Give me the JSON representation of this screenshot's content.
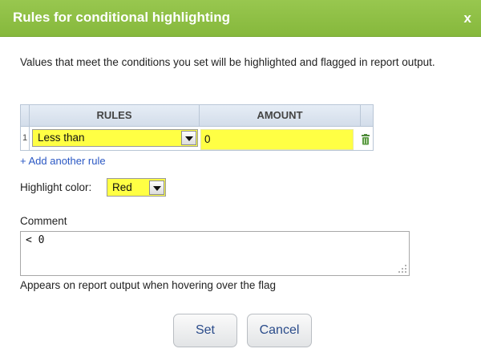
{
  "dialog": {
    "title": "Rules for conditional highlighting",
    "close_label": "x",
    "description": "Values that meet the conditions you set will be highlighted and flagged in report output."
  },
  "rules_table": {
    "columns": [
      "",
      "RULES",
      "AMOUNT",
      ""
    ],
    "rows": [
      {
        "number": "1",
        "rule": "Less than",
        "amount": "0"
      }
    ],
    "add_rule_label": "+ Add another rule"
  },
  "highlight": {
    "label": "Highlight color:",
    "value": "Red"
  },
  "comment": {
    "label": "Comment",
    "value": "< 0",
    "hint": "Appears on report output when hovering over the flag"
  },
  "buttons": {
    "set_label": "Set",
    "cancel_label": "Cancel"
  },
  "colors": {
    "titlebar": "#8cbd44",
    "highlight_field": "#ffff44",
    "link": "#2b58c4",
    "button_text": "#2a4b8a"
  },
  "icons": {
    "row_action": "trash-icon",
    "dropdown": "chevron-down-icon",
    "resize": "resize-grip-icon"
  }
}
